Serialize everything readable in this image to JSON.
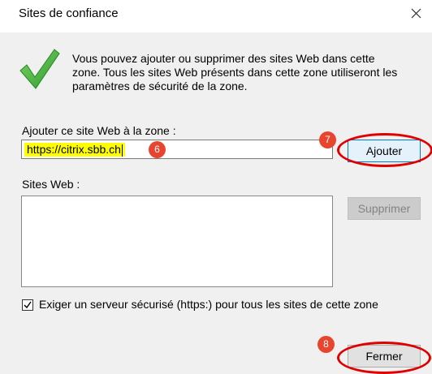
{
  "window": {
    "title": "Sites de confiance"
  },
  "info": {
    "line1": "Vous pouvez ajouter ou supprimer des sites Web dans cette",
    "line2": "zone. Tous les sites Web présents dans cette zone utiliseront les",
    "line3": "paramètres de sécurité de la zone."
  },
  "add_site": {
    "label": "Ajouter ce site Web à la zone :",
    "value": "https://citrix.sbb.ch",
    "button": "Ajouter"
  },
  "sites": {
    "label": "Sites Web :",
    "items": [],
    "remove_button": "Supprimer"
  },
  "https_requirement": {
    "checked": true,
    "label": "Exiger un serveur sécurisé (https:) pour tous les sites de cette zone"
  },
  "close_button": "Fermer",
  "annotations": {
    "step6": "6",
    "step7": "7",
    "step8": "8"
  },
  "colors": {
    "badge": "#e8452f",
    "highlight": "#ffff00",
    "ring": "#e00000",
    "accent": "#0078d7"
  },
  "icons": {
    "check": "checkmark-icon",
    "close": "close-icon"
  }
}
